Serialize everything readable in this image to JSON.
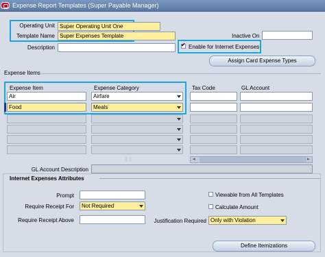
{
  "window": {
    "title": "Expense Report Templates (Super Payable Manager)"
  },
  "header": {
    "operating_unit_label": "Operating Unit",
    "operating_unit_value": "Super Operating Unit One",
    "template_name_label": "Template Name",
    "template_name_value": "Super Expenses Template",
    "description_label": "Description",
    "description_value": "",
    "inactive_on_label": "Inactive On",
    "inactive_on_value": "",
    "enable_internet_label": "Enable for Internet Expenses",
    "enable_internet_checked": true,
    "assign_card_button": "Assign Card Expense Types"
  },
  "expense_items": {
    "section_label": "Expense Items",
    "columns": {
      "expense_item": "Expense Item",
      "expense_category": "Expense Category",
      "tax_code": "Tax Code",
      "gl_account": "GL Account"
    },
    "rows": [
      {
        "expense_item": "Air",
        "expense_category": "Airfare",
        "tax_code": "",
        "gl_account": ""
      },
      {
        "expense_item": "Food",
        "expense_category": "Meals",
        "tax_code": "",
        "gl_account": ""
      }
    ],
    "gl_account_description_label": "GL Account Description",
    "gl_account_description_value": ""
  },
  "internet": {
    "section_label": "Internet Expenses Attributes",
    "prompt_label": "Prompt",
    "prompt_value": "",
    "require_receipt_for_label": "Require Receipt For",
    "require_receipt_for_value": "Not Required",
    "require_receipt_above_label": "Require Receipt Above",
    "require_receipt_above_value": "",
    "viewable_label": "Viewable from All Templates",
    "calculate_label": "Calculate Amount",
    "justification_label": "Justification Required",
    "justification_value": "Only with Violation",
    "define_itemizations_button": "Define Itemizations"
  },
  "colors": {
    "highlight": "#1aa6de",
    "required_field": "#ffef9d",
    "title_bar": "#5b79a3"
  }
}
